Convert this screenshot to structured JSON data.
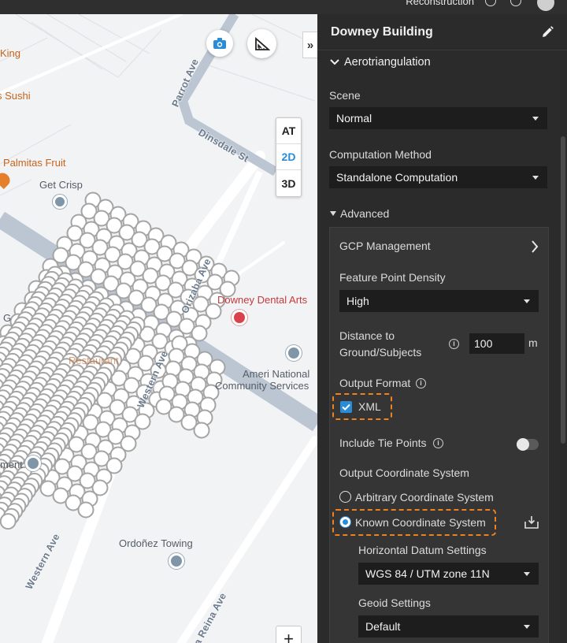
{
  "topbar": {
    "title": "Reconstruction"
  },
  "map": {
    "pois": {
      "king": "King",
      "sushi": "s Sushi",
      "palmitas": "Palmitas Fruit",
      "get_crisp": "Get Crisp",
      "dental": "Downey Dental Arts",
      "ameri_line1": "Ameri National",
      "ameri_line2": "Community Services",
      "restaurant": "Restaurant",
      "ordonez": "Ordoñez Towing",
      "ment": "ment",
      "g_label": "G"
    },
    "streets": {
      "parrot": "Parrot Ave",
      "dinsdale": "Dinsdale St",
      "orizaba": "Orizaba Ave",
      "western1": "Western Ave",
      "western2": "Western Ave",
      "reina": "La Reina Ave"
    },
    "view_modes": [
      "AT",
      "2D",
      "3D"
    ],
    "active_view": "2D",
    "collapse_label": "»",
    "zoom_in_label": "+"
  },
  "panel": {
    "title": "Downey Building",
    "section": "Aerotriangulation",
    "scene_label": "Scene",
    "scene_value": "Normal",
    "computation_label": "Computation Method",
    "computation_value": "Standalone Computation",
    "advanced_label": "Advanced",
    "gcp_label": "GCP Management",
    "density_label": "Feature Point Density",
    "density_value": "High",
    "distance_label_line1": "Distance to",
    "distance_label_line2": "Ground/Subjects",
    "distance_value": "100",
    "distance_unit": "m",
    "output_format_label": "Output Format",
    "xml_label": "XML",
    "tie_points_label": "Include Tie Points",
    "ocs_label": "Output Coordinate System",
    "arbitrary_label": "Arbitrary Coordinate System",
    "known_label": "Known Coordinate System",
    "horizontal_label": "Horizontal Datum Settings",
    "horizontal_value": "WGS 84 / UTM zone 11N",
    "geoid_label": "Geoid Settings",
    "geoid_value": "Default"
  },
  "colors": {
    "accent": "#2a8bd6",
    "highlight": "#f0821e",
    "panel_bg": "#2b2b2b",
    "poi_orange": "#c8631b"
  }
}
